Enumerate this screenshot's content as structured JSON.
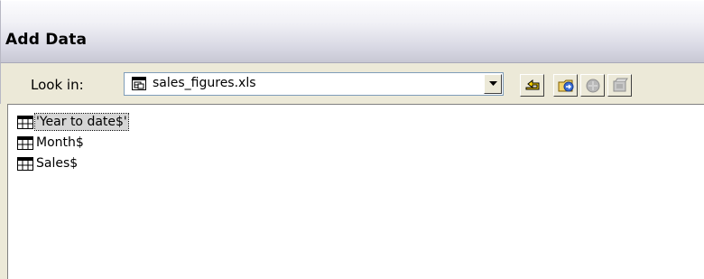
{
  "window": {
    "title": "Add Data"
  },
  "toolbar": {
    "look_in_label": "Look in:",
    "look_in_value": "sales_figures.xls"
  },
  "list": {
    "items": [
      {
        "label": "'Year to date$'",
        "selected": true
      },
      {
        "label": "Month$",
        "selected": false
      },
      {
        "label": "Sales$",
        "selected": false
      }
    ]
  },
  "icons": {
    "file": "spreadsheet-file-icon",
    "up": "up-one-level-icon",
    "connect": "connect-to-folder-icon",
    "disconnect": "disconnect-icon",
    "catalog": "catalog-icon",
    "table": "table-icon"
  }
}
